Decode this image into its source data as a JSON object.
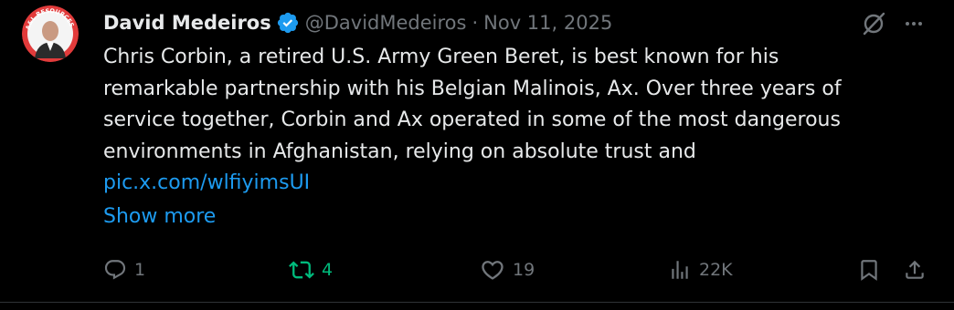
{
  "author": {
    "display_name": "David Medeiros",
    "handle": "@DavidMedeiros",
    "separator": "·",
    "date": "Nov 11, 2025",
    "verified": true,
    "avatar_icon": "profile-photo-avatar",
    "avatar_badge_text": "A&L RESOURCES"
  },
  "tweet": {
    "text_lines": [
      "Chris Corbin, a retired U.S. Army Green Beret, is best known for his",
      "remarkable partnership with his Belgian Malinois, Ax. Over three years of",
      "service together, Corbin and Ax operated in some of the most dangerous",
      "environments in Afghanistan, relying on absolute trust and"
    ],
    "link": "pic.x.com/wlfiyimsUI",
    "show_more": "Show more"
  },
  "actions": {
    "reply_count": "1",
    "repost_count": "4",
    "like_count": "19",
    "views_count": "22K"
  },
  "colors": {
    "background": "#000000",
    "text": "#e7e9ea",
    "muted": "#71767b",
    "link": "#1d9bf0",
    "repost_active": "#00ba7c",
    "verified": "#1d9bf0"
  },
  "icons": {
    "verified": "verified-badge-icon",
    "grok": "grok-icon",
    "more": "more-dots-icon",
    "reply": "reply-icon",
    "repost": "repost-icon",
    "like": "heart-icon",
    "views": "views-icon",
    "bookmark": "bookmark-icon",
    "share": "share-icon"
  }
}
